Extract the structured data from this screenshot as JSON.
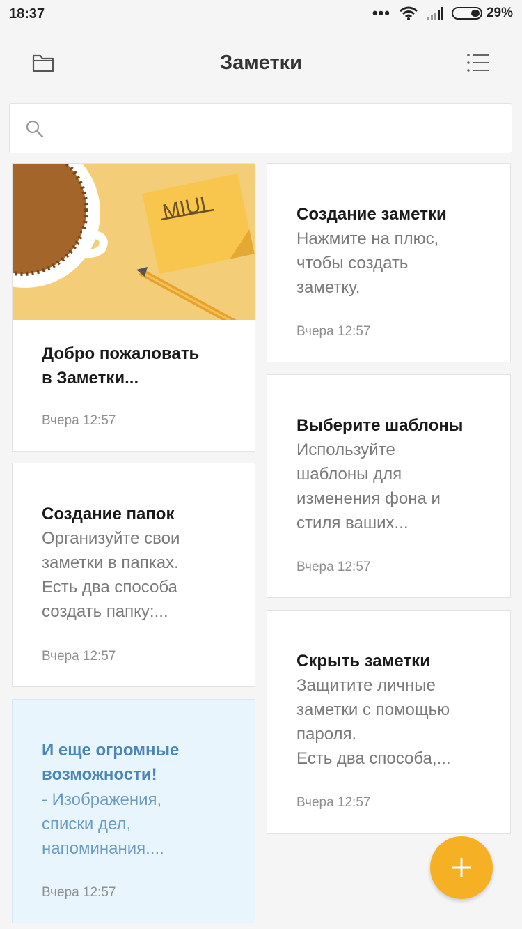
{
  "status_bar": {
    "time": "18:37",
    "dots": "•••",
    "battery": "29%"
  },
  "app_bar": {
    "title": "Заметки",
    "left_icon": "folder-icon",
    "right_icon": "menu-list-icon"
  },
  "search": {
    "placeholder": "",
    "icon": "search-icon"
  },
  "notes": [
    {
      "title": "Добро пожаловать\nв Заметки...",
      "body": "",
      "date": "Вчера 12:57",
      "image_text": "MIUI"
    },
    {
      "title": "Создание заметки",
      "body": "Нажмите на плюс,\nчтобы создать\nзаметку.",
      "date": "Вчера 12:57"
    },
    {
      "title": "Выберите шаблоны",
      "body": "Используйте\nшаблоны для\nизменения фона и\nстиля ваших...",
      "date": "Вчера 12:57"
    },
    {
      "title": "Создание папок",
      "body": "Организуйте свои\nзаметки в папках.\nЕсть два способа\nсоздать папку:...",
      "date": "Вчера 12:57"
    },
    {
      "title": "Скрыть заметки",
      "body": "Защитите личные\nзаметки с помощью\nпароля.\nЕсть два способа,...",
      "date": "Вчера 12:57"
    },
    {
      "title": "И еще огромные\nвозможности!",
      "body": "  - Изображения,\nсписки дел,\nнапоминания....",
      "date": "Вчера 12:57"
    }
  ],
  "colors": {
    "accent": "#f6b024",
    "blue_card_bg": "#e8f5fc",
    "blue_text": "#4a86b8"
  },
  "fab": {
    "icon": "plus-icon"
  }
}
